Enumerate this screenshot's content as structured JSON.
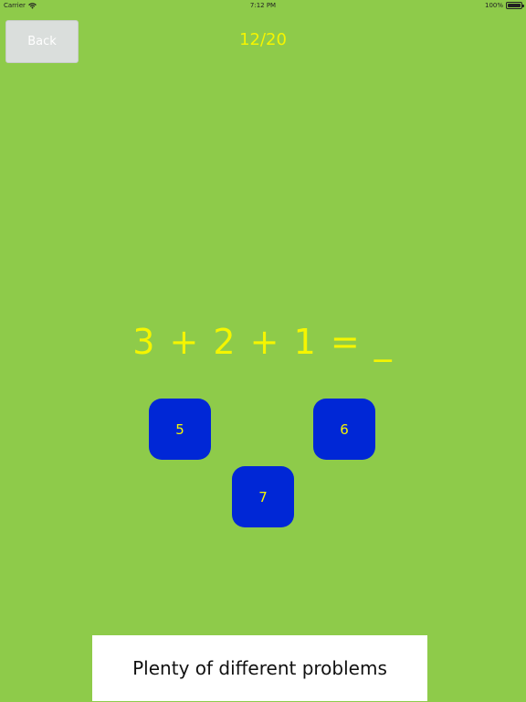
{
  "status_bar": {
    "carrier": "Carrier",
    "time": "7:12 PM",
    "battery": "100%"
  },
  "header": {
    "back_label": "Back",
    "progress": "12/20"
  },
  "problem": {
    "equation": "3 + 2 + 1 = _"
  },
  "answers": [
    "5",
    "6",
    "7"
  ],
  "caption": "Plenty of different problems",
  "colors": {
    "background": "#8ecb4a",
    "accent_text": "#f5f500",
    "answer_button": "#0027d6",
    "back_button": "#dadedc"
  }
}
